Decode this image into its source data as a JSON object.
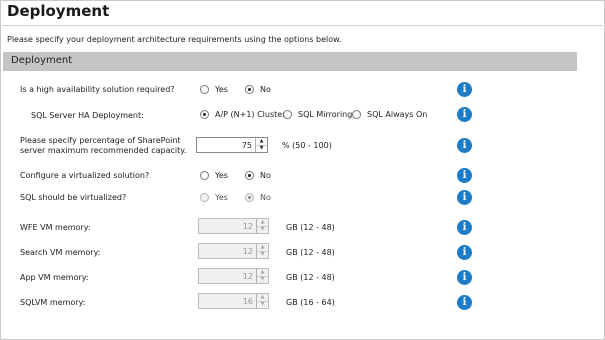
{
  "page": {
    "title": "Deployment",
    "description": "Please specify your deployment architecture requirements using the options below."
  },
  "section": {
    "title": "Deployment"
  },
  "ha": {
    "label": "Is a high availability solution required?",
    "options": [
      "Yes",
      "No"
    ],
    "selected": "No"
  },
  "sql_ha": {
    "label": "SQL Server HA Deployment:",
    "options": [
      "A/P (N+1) Cluster",
      "SQL Mirroring",
      "SQL Always On"
    ],
    "selected": "A/P (N+1) Cluster"
  },
  "capacity": {
    "label_line1": "Please specify percentage of SharePoint",
    "label_line2": "server maximum recommended capacity.",
    "value": "75",
    "unit": "% (50 - 100)"
  },
  "virtualized": {
    "label": "Configure a virtualized solution?",
    "options": [
      "Yes",
      "No"
    ],
    "selected": "No"
  },
  "sql_virtualized": {
    "label": "SQL should be virtualized?",
    "options": [
      "Yes",
      "No"
    ],
    "selected": "No"
  },
  "wfe_memory": {
    "label": "WFE VM memory:",
    "value": "12",
    "unit": "GB (12 - 48)"
  },
  "search_memory": {
    "label": "Search VM memory:",
    "value": "12",
    "unit": "GB (12 - 48)"
  },
  "app_memory": {
    "label": "App VM memory:",
    "value": "12",
    "unit": "GB (12 - 48)"
  },
  "sql_memory": {
    "label": "SQLVM memory:",
    "value": "16",
    "unit": "GB (16 - 64)"
  },
  "icons": {
    "info": "info-icon",
    "spin_up": "triangle-up",
    "spin_down": "triangle-down",
    "info_color": "#1b7cc9"
  }
}
